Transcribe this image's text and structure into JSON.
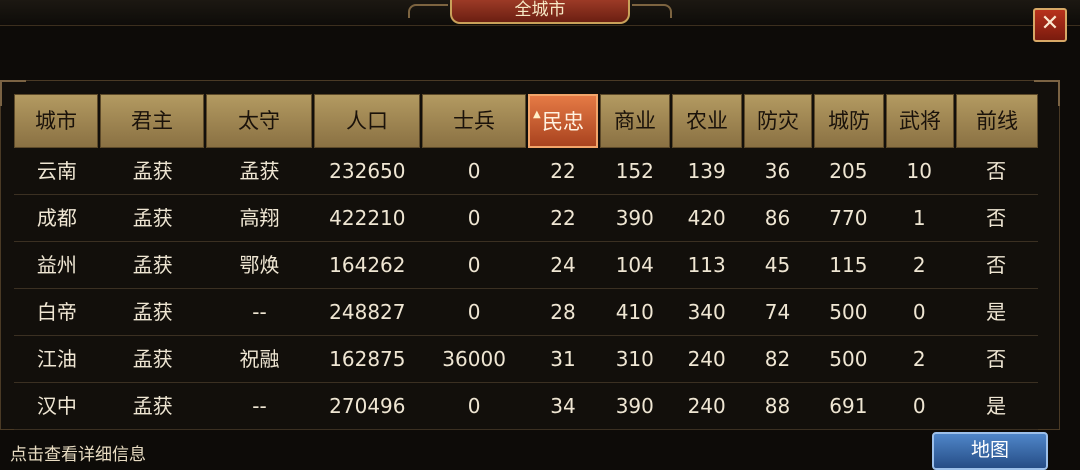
{
  "window": {
    "title": "全城市",
    "close_label": "✕"
  },
  "columns": [
    "城市",
    "君主",
    "太守",
    "人口",
    "士兵",
    "民忠",
    "商业",
    "农业",
    "防灾",
    "城防",
    "武将",
    "前线"
  ],
  "sorted_column": "民忠",
  "sort_indicator": "▲",
  "rows": [
    [
      "云南",
      "孟获",
      "孟获",
      "232650",
      "0",
      "22",
      "152",
      "139",
      "36",
      "205",
      "10",
      "否"
    ],
    [
      "成都",
      "孟获",
      "高翔",
      "422210",
      "0",
      "22",
      "390",
      "420",
      "86",
      "770",
      "1",
      "否"
    ],
    [
      "益州",
      "孟获",
      "鄂焕",
      "164262",
      "0",
      "24",
      "104",
      "113",
      "45",
      "115",
      "2",
      "否"
    ],
    [
      "白帝",
      "孟获",
      "--",
      "248827",
      "0",
      "28",
      "410",
      "340",
      "74",
      "500",
      "0",
      "是"
    ],
    [
      "江油",
      "孟获",
      "祝融",
      "162875",
      "36000",
      "31",
      "310",
      "240",
      "82",
      "500",
      "2",
      "否"
    ],
    [
      "汉中",
      "孟获",
      "--",
      "270496",
      "0",
      "34",
      "390",
      "240",
      "88",
      "691",
      "0",
      "是"
    ]
  ],
  "footer": {
    "hint": "点击查看详细信息",
    "map_button": "地图"
  },
  "colors": {
    "header_bg": "#a88e58",
    "active_header": "#d0652f",
    "close_button": "#a02a18",
    "map_button": "#3a6aa8"
  }
}
